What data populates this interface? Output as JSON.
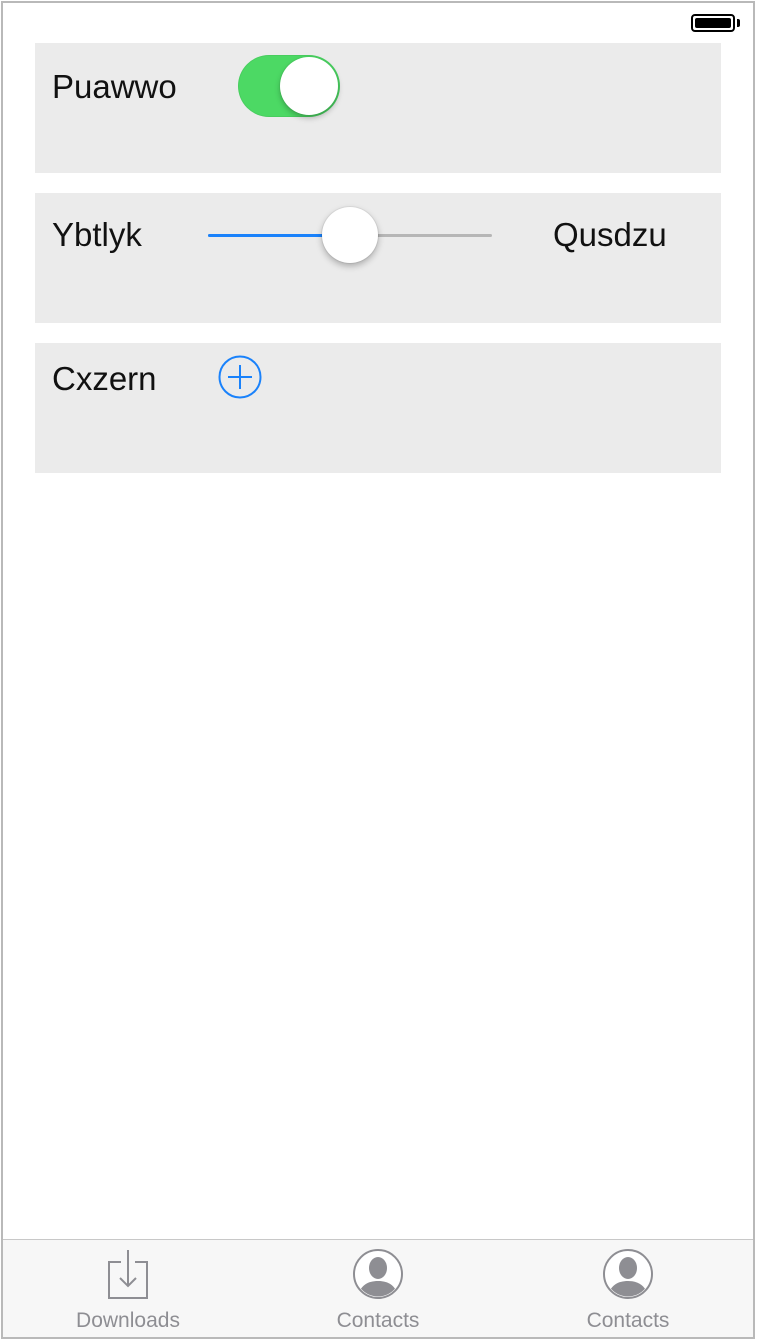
{
  "status_bar": {
    "battery_level": 1.0,
    "battery_icon": "battery-full-icon"
  },
  "controls": {
    "toggle_row": {
      "label": "Puawwo",
      "toggle_on": true,
      "accent_color": "#4cd964"
    },
    "slider_row": {
      "label": "Ybtlyk",
      "value_label": "Qusdzu",
      "slider_fraction": 0.5,
      "accent_color": "#1a82fb"
    },
    "add_row": {
      "label": "Cxzern",
      "add_icon": "plus-circle-icon",
      "accent_color": "#1a82fb"
    }
  },
  "tab_bar": {
    "items": [
      {
        "label": "Downloads",
        "icon": "downloads-icon"
      },
      {
        "label": "Contacts",
        "icon": "contacts-icon"
      },
      {
        "label": "Contacts",
        "icon": "contacts-icon"
      }
    ]
  }
}
